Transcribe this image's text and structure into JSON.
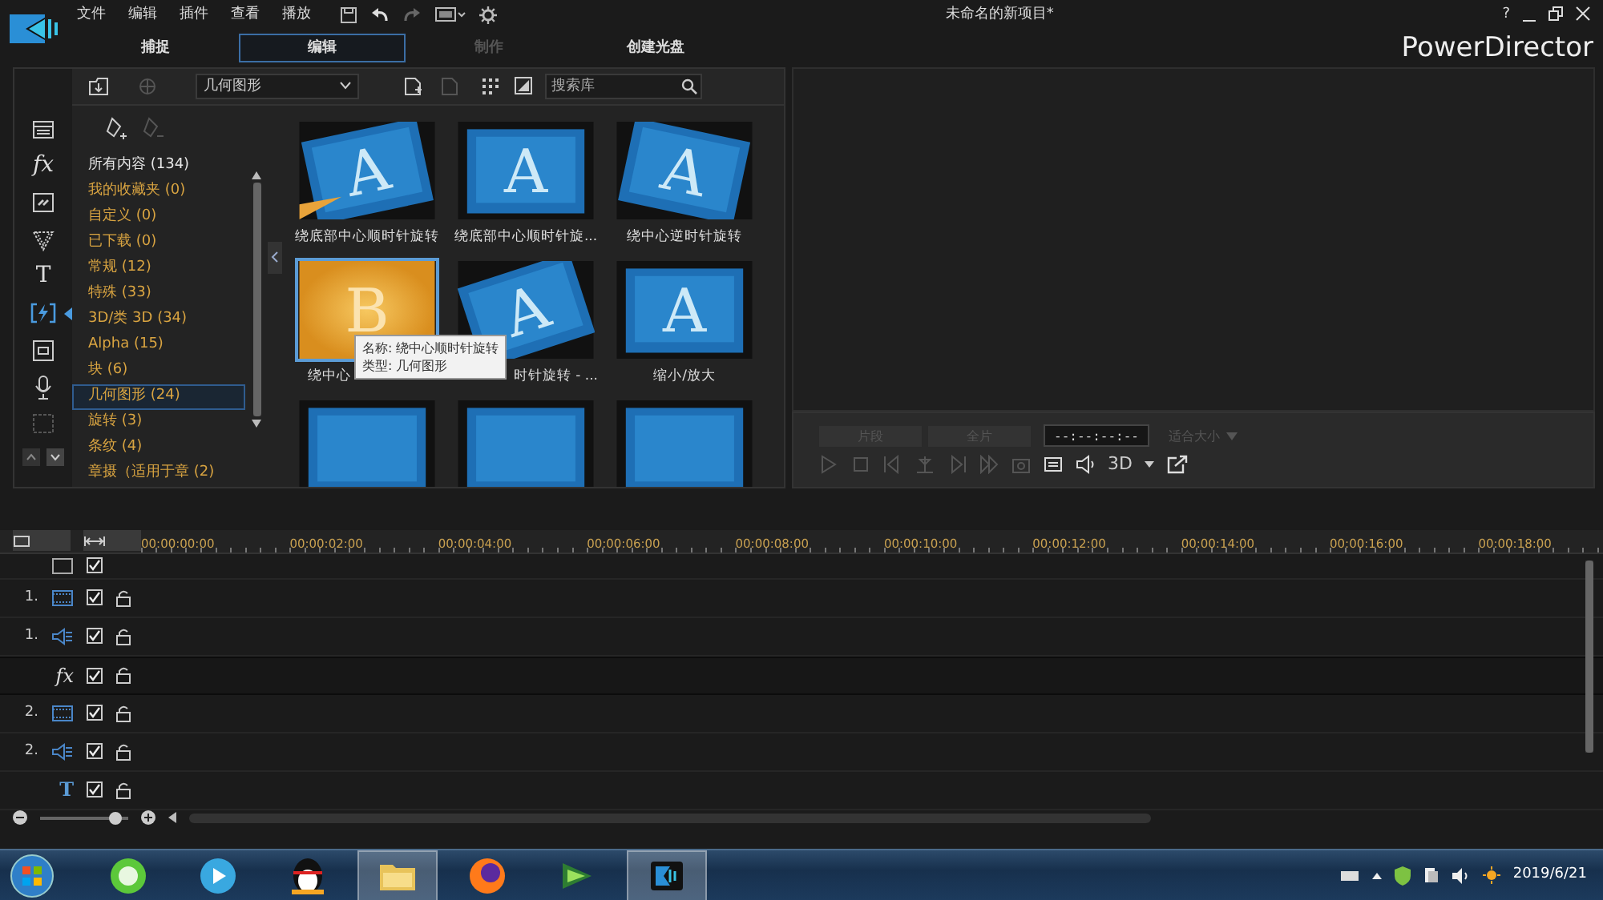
{
  "app": {
    "menu": [
      "文件",
      "编辑",
      "插件",
      "查看",
      "播放"
    ],
    "title": "未命名的新项目*",
    "help": "?",
    "brand": "PowerDirector"
  },
  "mode_tabs": [
    {
      "label": "捕捉",
      "selected": false,
      "disabled": false
    },
    {
      "label": "编辑",
      "selected": true,
      "disabled": false
    },
    {
      "label": "制作",
      "selected": false,
      "disabled": true
    },
    {
      "label": "创建光盘",
      "selected": false,
      "disabled": false
    }
  ],
  "rail": [
    {
      "kind": "media",
      "selected": false
    },
    {
      "kind": "text",
      "text": "fx",
      "selected": false
    },
    {
      "kind": "pip",
      "selected": false
    },
    {
      "kind": "particle",
      "selected": false
    },
    {
      "kind": "text",
      "text": "T",
      "selected": false
    },
    {
      "kind": "transition",
      "selected": true
    },
    {
      "kind": "chapter",
      "selected": false
    },
    {
      "kind": "voice",
      "selected": false
    },
    {
      "kind": "subtitle",
      "selected": false
    }
  ],
  "library": {
    "dropdown": "几何图形",
    "search_placeholder": "搜索库",
    "categories": [
      {
        "kind": "all",
        "label": "所有内容",
        "count": "(134)",
        "selected": false
      },
      {
        "kind": "category",
        "label": "我的收藏夹",
        "count": "(0)",
        "selected": false
      },
      {
        "kind": "category",
        "label": "自定义",
        "count": "(0)",
        "selected": false
      },
      {
        "kind": "category",
        "label": "已下载",
        "count": "(0)",
        "selected": false
      },
      {
        "kind": "category",
        "label": "常规",
        "count": "(12)",
        "selected": false
      },
      {
        "kind": "category",
        "label": "特殊",
        "count": "(33)",
        "selected": false
      },
      {
        "kind": "category",
        "label": "3D/类 3D",
        "count": "(34)",
        "selected": false
      },
      {
        "kind": "category",
        "label": "Alpha",
        "count": "(15)",
        "selected": false
      },
      {
        "kind": "category",
        "label": "块",
        "count": "(6)",
        "selected": false
      },
      {
        "kind": "category",
        "label": "几何图形",
        "count": "(24)",
        "selected": true
      },
      {
        "kind": "category",
        "label": "旋转",
        "count": "(3)",
        "selected": false
      },
      {
        "kind": "category",
        "label": "条纹",
        "count": "(4)",
        "selected": false
      },
      {
        "kind": "category",
        "label": "章摄（适用于章",
        "count": "(2)",
        "selected": false
      }
    ],
    "items": [
      {
        "glyph": "A",
        "label": "绕底部中心顺时针旋转",
        "selected": false
      },
      {
        "glyph": "A",
        "label": "绕底部中心顺时针旋...",
        "selected": false
      },
      {
        "glyph": "A",
        "label": "绕中心逆时针旋转",
        "selected": false
      },
      {
        "glyph": "B",
        "label": "绕中心",
        "selected": true
      },
      {
        "glyph": "A",
        "label": "时针旋转 - ...",
        "selected": false
      },
      {
        "glyph": "A",
        "label": "缩小/放大",
        "selected": false
      },
      {
        "selected": false
      },
      {
        "selected": false
      },
      {
        "selected": false
      }
    ],
    "tooltip": [
      "名称: 绕中心顺时针旋转",
      "类型: 几何图形"
    ]
  },
  "preview": {
    "buttons": [
      {
        "label": "片段",
        "disabled": true
      },
      {
        "label": "全片",
        "disabled": true
      }
    ],
    "timecode": "--:--:--:--",
    "fit": {
      "label": "适合大小",
      "disabled": true
    },
    "transport": [
      {
        "kind": "play",
        "disabled": true
      },
      {
        "kind": "stop",
        "disabled": true
      },
      {
        "kind": "prev",
        "disabled": true
      },
      {
        "kind": "split",
        "disabled": true
      },
      {
        "kind": "next",
        "disabled": true
      },
      {
        "kind": "forward",
        "disabled": true
      },
      {
        "kind": "camera",
        "disabled": true
      },
      {
        "kind": "subtitle",
        "disabled": false
      },
      {
        "kind": "volume",
        "disabled": false
      }
    ],
    "mode_3d": "3D"
  },
  "timeline": {
    "ruler": [
      "00:00:00:00",
      "00:00:02:00",
      "00:00:04:00",
      "00:00:06:00",
      "00:00:08:00",
      "00:00:10:00",
      "00:00:12:00",
      "00:00:14:00",
      "00:00:16:00",
      "00:00:18:00"
    ],
    "tracks": [
      {
        "kind": "blank",
        "checked": true,
        "selected": false
      },
      {
        "kind": "video",
        "number": "1.",
        "checked": true,
        "locked": false,
        "selected": false
      },
      {
        "kind": "audio",
        "number": "1.",
        "checked": true,
        "locked": false,
        "selected": false
      },
      {
        "kind": "text",
        "text": "fx",
        "checked": true,
        "locked": false,
        "selected": true
      },
      {
        "kind": "video",
        "number": "2.",
        "checked": true,
        "locked": false,
        "selected": false
      },
      {
        "kind": "audio",
        "number": "2.",
        "checked": true,
        "locked": false,
        "selected": false
      },
      {
        "kind": "title",
        "text": "T",
        "checked": true,
        "locked": false,
        "selected": false
      }
    ],
    "zoom": {
      "level": 0.85
    }
  },
  "taskbar": {
    "apps": [
      {
        "kind": "ie",
        "active": false
      },
      {
        "kind": "player",
        "active": false
      },
      {
        "kind": "penguin",
        "active": false
      },
      {
        "kind": "folder",
        "active": true
      },
      {
        "kind": "firefox",
        "active": false
      },
      {
        "kind": "director2",
        "active": false
      },
      {
        "kind": "director",
        "active": true
      }
    ],
    "date": "2019/6/21"
  }
}
